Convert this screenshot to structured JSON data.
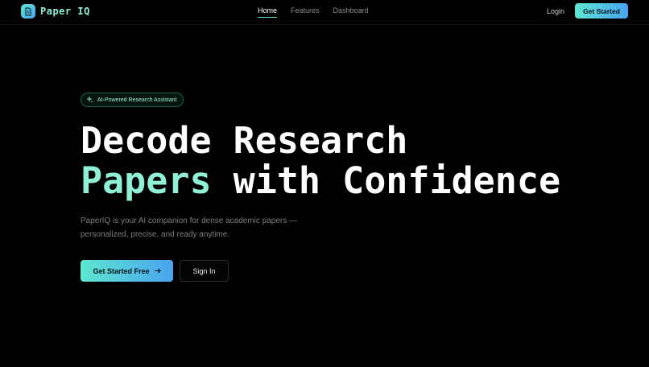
{
  "nav": {
    "logo_text": "Paper IQ",
    "logo_icon": "document-icon",
    "links": [
      {
        "label": "Home",
        "active": true
      },
      {
        "label": "Features",
        "active": false
      },
      {
        "label": "Dashboard",
        "active": false
      }
    ],
    "login_label": "Login",
    "cta_label": "Get Started"
  },
  "hero": {
    "badge_icon": "sparkle-icon",
    "badge_text": "AI-Powered Research Assistant",
    "headline_line1": "Decode Research",
    "headline_accent": "Papers",
    "headline_rest": " with Confidence",
    "subtitle": "PaperIQ is your AI companion for dense academic papers — personalized, precise, and ready anytime.",
    "primary_button": "Get Started Free",
    "primary_button_icon": "arrow-right-icon",
    "secondary_button": "Sign In"
  },
  "colors": {
    "background": "#000000",
    "accent_mint": "#8ff0d6",
    "gradient_start": "#5ee7d0",
    "gradient_end": "#4aa3f0",
    "muted_text": "#7d7d7d"
  }
}
